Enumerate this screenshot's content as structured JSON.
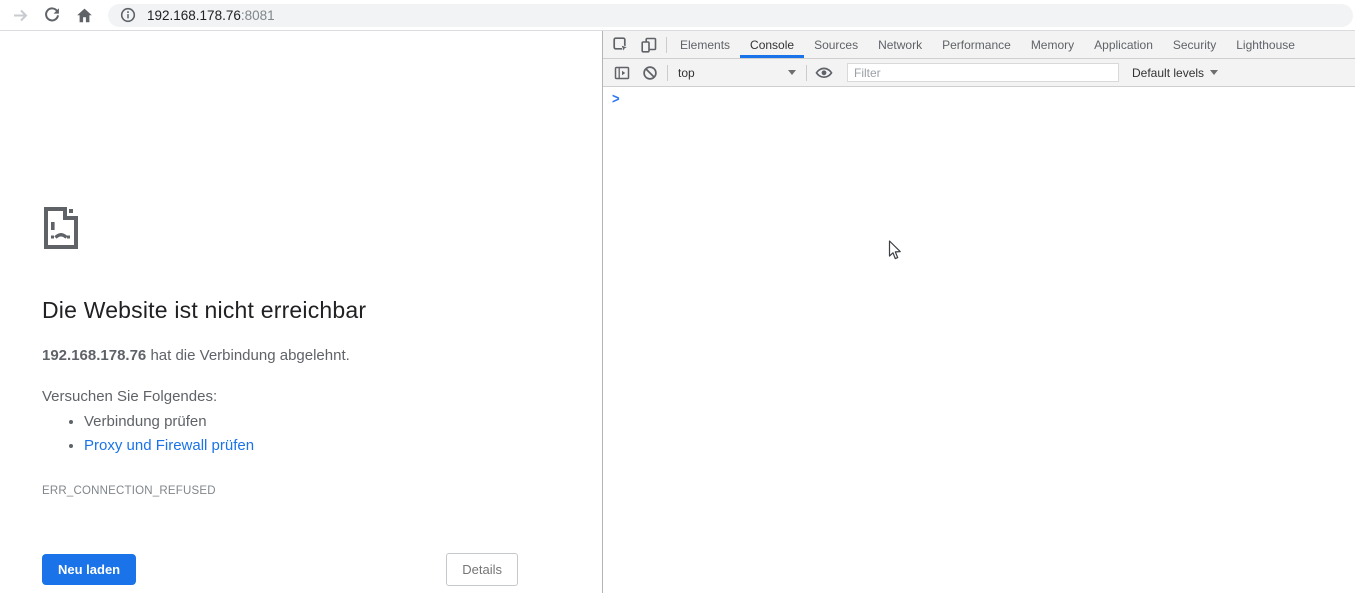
{
  "browser": {
    "url": {
      "host": "192.168.178.76",
      "port": ":8081"
    }
  },
  "error_page": {
    "title": "Die Website ist nicht erreichbar",
    "message": {
      "host": "192.168.178.76",
      "rest": " hat die Verbindung abgelehnt."
    },
    "suggestions_heading": "Versuchen Sie Folgendes:",
    "suggestions": [
      {
        "label": "Verbindung prüfen"
      },
      {
        "label": "Proxy und Firewall prüfen"
      }
    ],
    "error_code": "ERR_CONNECTION_REFUSED",
    "buttons": {
      "reload": "Neu laden",
      "details": "Details"
    }
  },
  "devtools": {
    "tabs": [
      "Elements",
      "Console",
      "Sources",
      "Network",
      "Performance",
      "Memory",
      "Application",
      "Security",
      "Lighthouse"
    ],
    "active_tab": "Console",
    "toolbar": {
      "context": "top",
      "filter_placeholder": "Filter",
      "levels": "Default levels"
    },
    "console": {
      "prompt": ">"
    }
  },
  "icons": {
    "nav": [
      "forward-arrow-icon",
      "reload-icon",
      "home-icon",
      "info-icon"
    ],
    "error": "sad-file-icon",
    "devtools": [
      "inspect-element-icon",
      "toggle-device-toolbar-icon",
      "console-sidebar-icon",
      "clear-console-icon",
      "eye-icon",
      "dropdown-caret-icon"
    ]
  },
  "colors": {
    "accent_blue": "#1a73e8",
    "link_blue": "#1a73e8",
    "text_primary": "#202124",
    "text_secondary": "#5f6368",
    "toolbar_bg": "#f3f3f3",
    "omnibox_bg": "#f1f3f4"
  }
}
